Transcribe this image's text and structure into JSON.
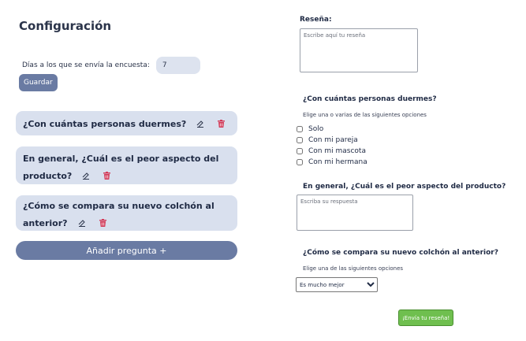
{
  "config": {
    "title": "Configuración",
    "days_label": "Días a los que se envía la encuesta:",
    "days_value": "7",
    "save_label": "Guardar",
    "questions": [
      {
        "text": "¿Con cuántas personas duermes?"
      },
      {
        "text": "En general, ¿Cuál es el peor aspecto del producto?"
      },
      {
        "text": "¿Cómo se compara su nuevo colchón al anterior?"
      }
    ],
    "add_label": "Añadir pregunta +",
    "icons": {
      "edit": "pencil-icon",
      "delete": "trash-icon"
    },
    "colors": {
      "accent": "#6a7ba3",
      "card": "#d9e0ee",
      "delete": "#d33c5a",
      "submit": "#6fbf4f"
    }
  },
  "preview": {
    "review_label": "Reseña:",
    "review_placeholder": "Escribe aquí tu reseña",
    "q1": {
      "title": "¿Con cuántas personas duermes?",
      "subtitle": "Elige una o varias de las siguientes opciones",
      "options": [
        "Solo",
        "Con mi pareja",
        "Con mi mascota",
        "Con mi hermana"
      ]
    },
    "q2": {
      "title": "En general, ¿Cuál es el peor aspecto del producto?",
      "placeholder": "Escriba su respuesta"
    },
    "q3": {
      "title": "¿Cómo se compara su nuevo colchón al anterior?",
      "subtitle": "Elige una de las siguientes opciones",
      "selected": "Es mucho mejor"
    },
    "submit_label": "¡Envía tu reseña!"
  }
}
